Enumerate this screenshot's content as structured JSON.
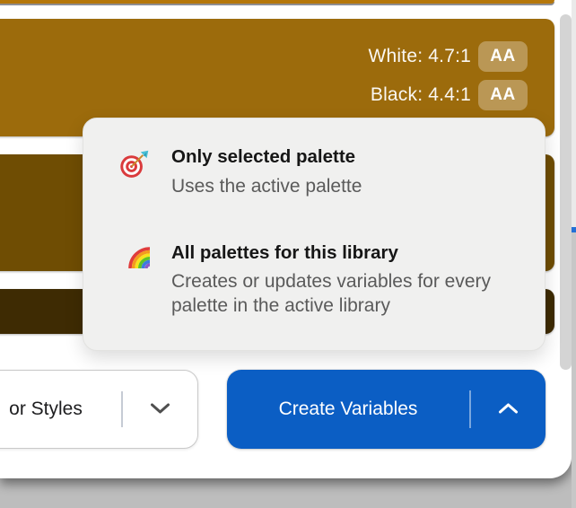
{
  "palette": {
    "rows": [
      {
        "color": "#B5770B"
      },
      {
        "color": "#9C6B0C",
        "contrast": [
          {
            "label": "White: 4.7:1",
            "badge": "AA"
          },
          {
            "label": "Black: 4.4:1",
            "badge": "AA"
          }
        ]
      },
      {
        "color": "#6F4D03"
      },
      {
        "color": "#3E2B03"
      }
    ]
  },
  "menu": {
    "background": "#F0F0EF",
    "items": [
      {
        "icon": "dart-target-emoji",
        "title": "Only selected palette",
        "description": "Uses the active palette"
      },
      {
        "icon": "rainbow-emoji",
        "title": "All palettes for this library",
        "description": "Creates or updates variables for every palette in the active library"
      }
    ]
  },
  "footer": {
    "styles_button": {
      "label": "or Styles"
    },
    "create_variables_button": {
      "label": "Create Variables",
      "color": "#0B5EC4"
    }
  },
  "scrollbar": {
    "thumb_color": "#D4D4D4"
  },
  "edge": {
    "accent_color": "#2470D6"
  }
}
